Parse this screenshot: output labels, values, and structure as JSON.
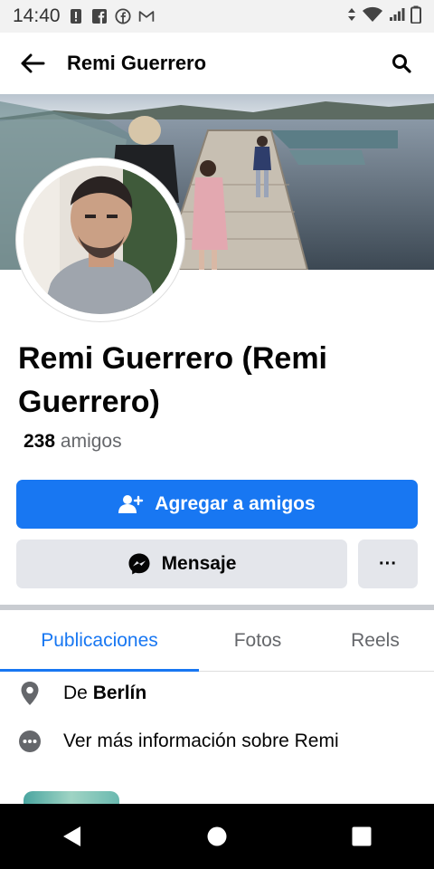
{
  "status_bar": {
    "time": "14:40"
  },
  "header": {
    "title": "Remi Guerrero"
  },
  "profile": {
    "name": "Remi Guerrero (Remi Guerrero)",
    "friends_count": "238",
    "friends_label": "amigos"
  },
  "actions": {
    "add_friend": "Agregar a amigos",
    "message": "Mensaje",
    "more": "···"
  },
  "tabs": [
    {
      "label": "Publicaciones",
      "active": true
    },
    {
      "label": "Fotos",
      "active": false
    },
    {
      "label": "Reels",
      "active": false
    }
  ],
  "info": {
    "location_prefix": "De",
    "location_city": "Berlín",
    "more_info": "Ver más información sobre Remi"
  },
  "colors": {
    "accent": "#1877f2",
    "button_secondary": "#e4e6eb"
  },
  "icons": [
    "back-arrow-icon",
    "search-icon",
    "add-friend-icon",
    "messenger-icon",
    "location-pin-icon",
    "more-info-icon",
    "nav-back-icon",
    "nav-home-icon",
    "nav-recents-icon"
  ]
}
